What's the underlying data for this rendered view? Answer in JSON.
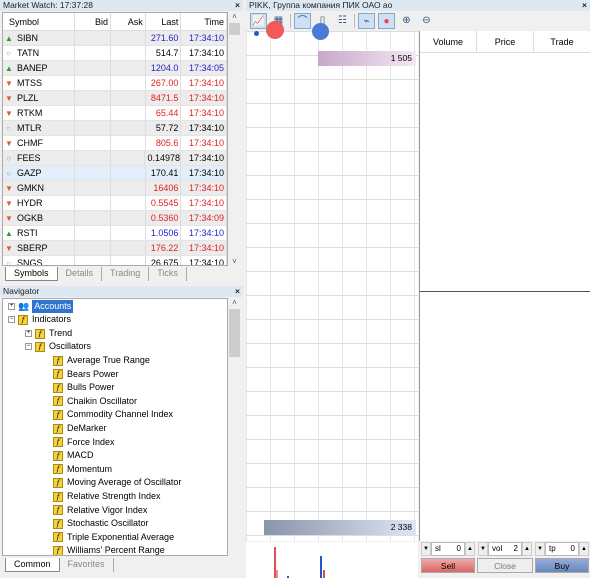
{
  "market_watch": {
    "title": "Market Watch: 17:37:28",
    "columns": [
      "Symbol",
      "Bid",
      "Ask",
      "Last",
      "Time"
    ],
    "rows": [
      {
        "symbol": "SIBN",
        "dir": "up",
        "last": "271.60",
        "time": "17:34:10"
      },
      {
        "symbol": "TATN",
        "dir": "none",
        "last": "514.7",
        "time": "17:34:10"
      },
      {
        "symbol": "BANEP",
        "dir": "up",
        "last": "1204.0",
        "time": "17:34:05"
      },
      {
        "symbol": "MTSS",
        "dir": "down",
        "last": "267.00",
        "time": "17:34:10"
      },
      {
        "symbol": "PLZL",
        "dir": "down",
        "last": "8471.5",
        "time": "17:34:10"
      },
      {
        "symbol": "RTKM",
        "dir": "down",
        "last": "65.44",
        "time": "17:34:10"
      },
      {
        "symbol": "MTLR",
        "dir": "none",
        "last": "57.72",
        "time": "17:34:10"
      },
      {
        "symbol": "CHMF",
        "dir": "down",
        "last": "805.6",
        "time": "17:34:10"
      },
      {
        "symbol": "FEES",
        "dir": "none",
        "last": "0.14978",
        "time": "17:34:10"
      },
      {
        "symbol": "GAZP",
        "dir": "none",
        "last": "170.41",
        "time": "17:34:10",
        "selected": true
      },
      {
        "symbol": "GMKN",
        "dir": "down",
        "last": "16406",
        "time": "17:34:10"
      },
      {
        "symbol": "HYDR",
        "dir": "down",
        "last": "0.5545",
        "time": "17:34:10"
      },
      {
        "symbol": "OGKB",
        "dir": "down",
        "last": "0.5360",
        "time": "17:34:09"
      },
      {
        "symbol": "RSTI",
        "dir": "up",
        "last": "1.0506",
        "time": "17:34:10"
      },
      {
        "symbol": "SBERP",
        "dir": "down",
        "last": "176.22",
        "time": "17:34:10"
      },
      {
        "symbol": "SNGS",
        "dir": "none",
        "last": "26.675",
        "time": "17:34:10"
      }
    ],
    "tabs": [
      "Symbols",
      "Details",
      "Trading",
      "Ticks"
    ]
  },
  "navigator": {
    "title": "Navigator",
    "accounts": "Accounts",
    "indicators": "Indicators",
    "trend": "Trend",
    "oscillators": "Oscillators",
    "items": [
      "Average True Range",
      "Bears Power",
      "Bulls Power",
      "Chaikin Oscillator",
      "Commodity Channel Index",
      "DeMarker",
      "Force Index",
      "MACD",
      "Momentum",
      "Moving Average of Oscillator",
      "Relative Strength Index",
      "Relative Vigor Index",
      "Stochastic Oscillator",
      "Triple Exponential Average",
      "Williams' Percent Range"
    ],
    "tabs": [
      "Common",
      "Favorites"
    ]
  },
  "depth": {
    "title": "PIKK, Группа компания ПИК ОАО ао",
    "columns": [
      "Volume",
      "Price",
      "Trade"
    ],
    "ask_volume": "1 505",
    "bid_volume": "2 338",
    "sl_label": "sl",
    "sl": "0",
    "vol_label": "vol",
    "vol": "2",
    "tp_label": "tp",
    "tp": "0",
    "sell": "Sell",
    "close": "Close",
    "buy": "Buy"
  },
  "colors": {
    "up": "#2a9d2a",
    "down": "#e0583a",
    "sell": "#e07070",
    "buy": "#7090c8"
  }
}
